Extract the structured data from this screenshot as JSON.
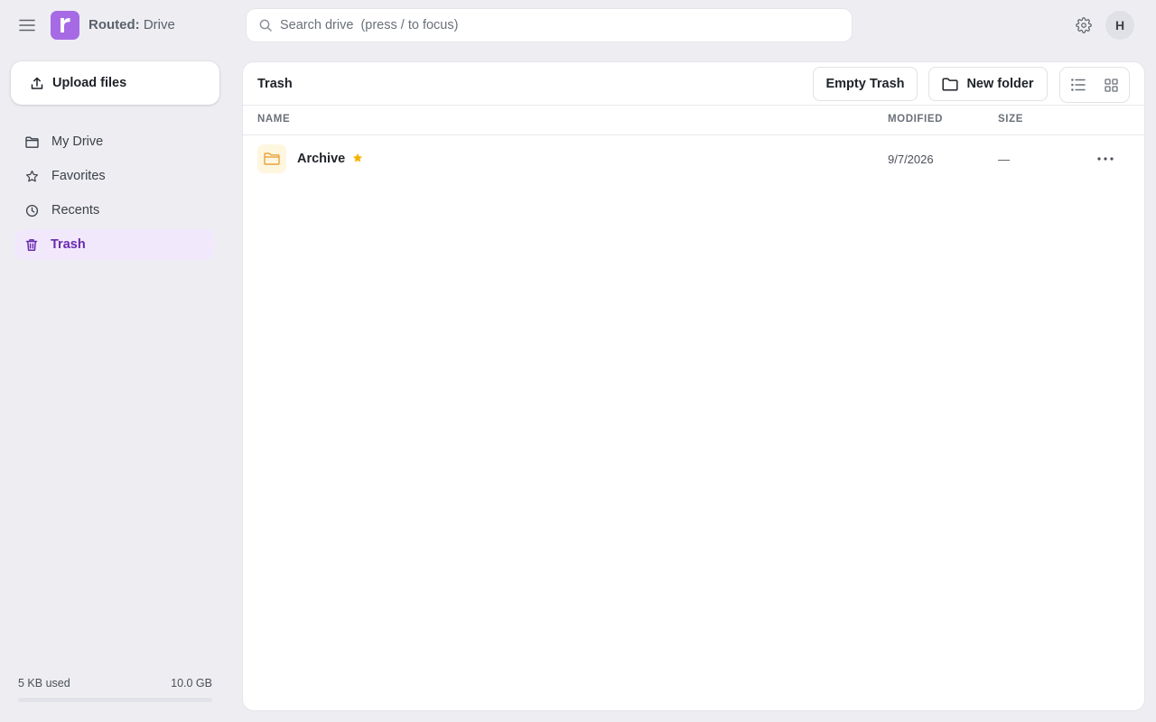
{
  "app": {
    "brand_bold": "Routed:",
    "brand_rest": " Drive",
    "logo_letter": "r",
    "accent_color": "#a66be4",
    "icons": {
      "menu": "hamburger-icon",
      "search": "search-icon",
      "settings": "gear-icon"
    }
  },
  "search": {
    "placeholder": "Search drive  (press / to focus)",
    "value": ""
  },
  "user": {
    "avatar_initial": "H"
  },
  "sidebar": {
    "upload_label": "Upload files",
    "upload_icon": "upload-icon",
    "items": [
      {
        "label": "My Drive",
        "icon": "folder-icon",
        "active": false
      },
      {
        "label": "Favorites",
        "icon": "star-icon",
        "active": false
      },
      {
        "label": "Recents",
        "icon": "clock-icon",
        "active": false
      },
      {
        "label": "Trash",
        "icon": "trash-icon",
        "active": true
      }
    ],
    "storage": {
      "used": "5 KB used",
      "total": "10.0 GB",
      "used_fraction": 0.0
    }
  },
  "main": {
    "title": "Trash",
    "empty_trash_label": "Empty Trash",
    "new_folder_label": "New folder",
    "view_modes": [
      "list",
      "grid"
    ],
    "columns": {
      "name": "NAME",
      "modified": "MODIFIED",
      "size": "SIZE"
    },
    "rows": [
      {
        "name": "Archive",
        "type": "folder",
        "starred": true,
        "modified": "9/7/2026",
        "size": "—"
      }
    ],
    "colors": {
      "folder": "#e9a23b",
      "star": "#f5b301",
      "active_nav": "#6a2bb0"
    }
  }
}
